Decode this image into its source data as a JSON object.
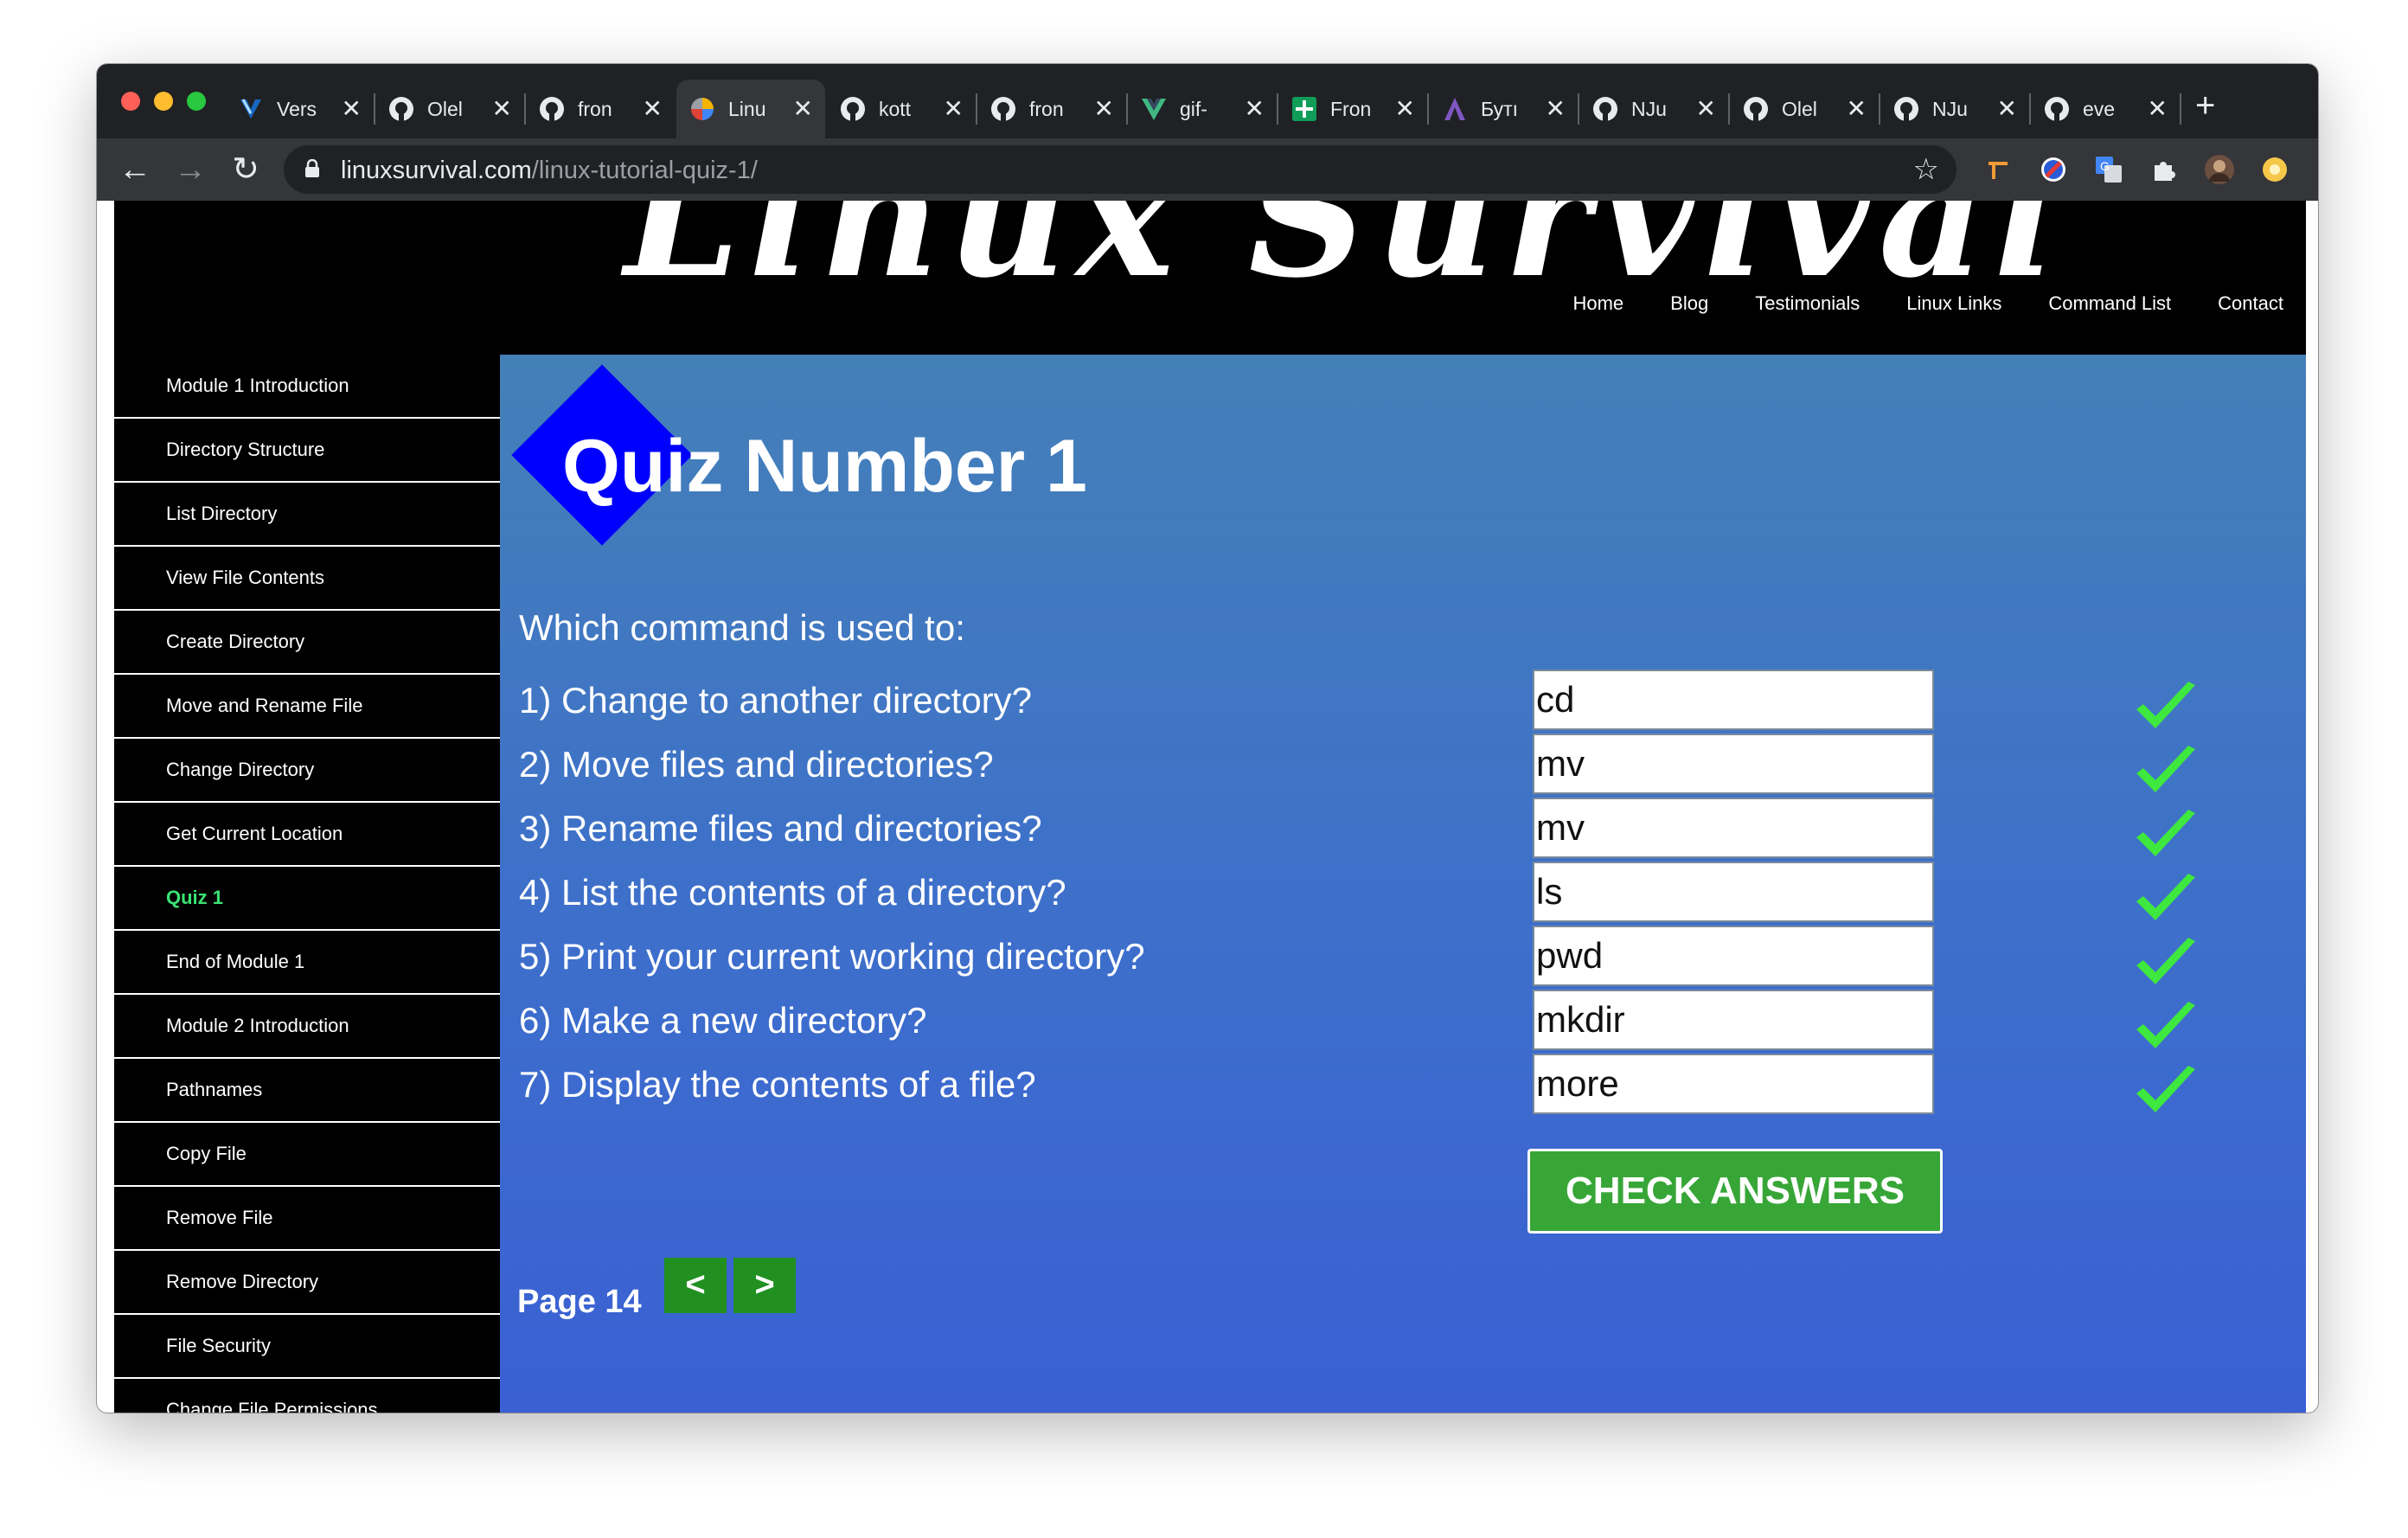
{
  "browser": {
    "tabs": [
      {
        "title": "Vers",
        "icon": "vuetify-icon",
        "active": false
      },
      {
        "title": "Olel",
        "icon": "github-icon",
        "active": false
      },
      {
        "title": "fron",
        "icon": "github-icon",
        "active": false
      },
      {
        "title": "Linu",
        "icon": "pinwheel-icon",
        "active": true
      },
      {
        "title": "kott",
        "icon": "github-icon",
        "active": false
      },
      {
        "title": "fron",
        "icon": "github-icon",
        "active": false
      },
      {
        "title": "gif-",
        "icon": "vue-icon",
        "active": false
      },
      {
        "title": "Fron",
        "icon": "green-plus-icon",
        "active": false
      },
      {
        "title": "Бутı",
        "icon": "purple-a-icon",
        "active": false
      },
      {
        "title": "NJu",
        "icon": "github-icon",
        "active": false
      },
      {
        "title": "Olel",
        "icon": "github-icon",
        "active": false
      },
      {
        "title": "NJu",
        "icon": "github-icon",
        "active": false
      },
      {
        "title": "eve",
        "icon": "github-icon",
        "active": false
      }
    ],
    "tab_close": "✕",
    "new_tab": "+",
    "address": {
      "host": "linuxsurvival.com",
      "path": "/linux-tutorial-quiz-1/"
    },
    "extensions": [
      "orange-tag-icon",
      "blue-red-circle-icon",
      "google-translate-icon",
      "puzzle-icon",
      "avatar",
      "yellow-circle-icon"
    ]
  },
  "site": {
    "banner": "Linux Survival",
    "nav": [
      "Home",
      "Blog",
      "Testimonials",
      "Linux Links",
      "Command List",
      "Contact"
    ]
  },
  "sidebar": {
    "items": [
      {
        "label": "Module 1 Introduction",
        "active": false
      },
      {
        "label": "Directory Structure",
        "active": false
      },
      {
        "label": "List Directory",
        "active": false
      },
      {
        "label": "View File Contents",
        "active": false
      },
      {
        "label": "Create Directory",
        "active": false
      },
      {
        "label": "Move and Rename File",
        "active": false
      },
      {
        "label": "Change Directory",
        "active": false
      },
      {
        "label": "Get Current Location",
        "active": false
      },
      {
        "label": "Quiz 1",
        "active": true
      },
      {
        "label": "End of Module 1",
        "active": false
      },
      {
        "label": "Module 2 Introduction",
        "active": false
      },
      {
        "label": "Pathnames",
        "active": false
      },
      {
        "label": "Copy File",
        "active": false
      },
      {
        "label": "Remove File",
        "active": false
      },
      {
        "label": "Remove Directory",
        "active": false
      },
      {
        "label": "File Security",
        "active": false
      },
      {
        "label": "Change File Permissions",
        "active": false
      }
    ]
  },
  "quiz": {
    "title": "Quiz Number 1",
    "intro": "Which command is used to:",
    "questions": [
      {
        "text": "1) Change to another directory?",
        "answer": "cd",
        "correct": true
      },
      {
        "text": "2) Move files and directories?",
        "answer": "mv",
        "correct": true
      },
      {
        "text": "3) Rename files and directories?",
        "answer": "mv",
        "correct": true
      },
      {
        "text": "4) List the contents of a directory?",
        "answer": "ls",
        "correct": true
      },
      {
        "text": "5) Print your current working directory?",
        "answer": "pwd",
        "correct": true
      },
      {
        "text": "6) Make a new directory?",
        "answer": "mkdir",
        "correct": true
      },
      {
        "text": "7) Display the contents of a file?",
        "answer": "more",
        "correct": true
      }
    ],
    "check_label": "CHECK ANSWERS",
    "page_label": "Page 14",
    "prev_label": "<",
    "next_label": ">"
  },
  "colors": {
    "active_sidebar": "#3ae374",
    "check_mark": "#3ee83e",
    "button_green": "#37a637",
    "pager_green": "#219021",
    "diamond": "#0000ff"
  }
}
